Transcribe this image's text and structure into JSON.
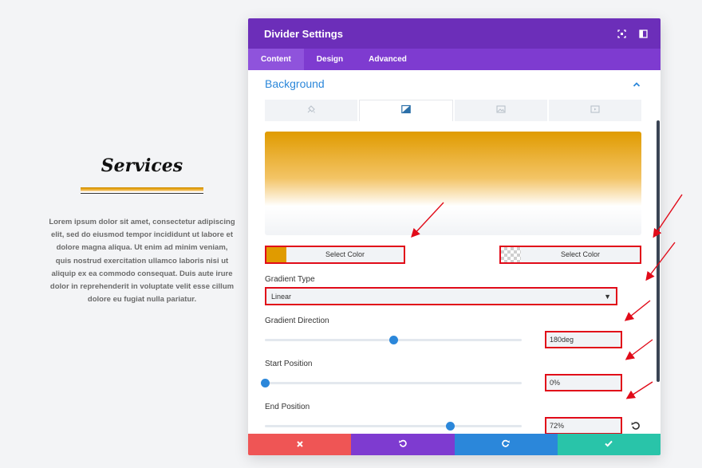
{
  "preview": {
    "heading": "Services",
    "body": "Lorem ipsum dolor sit amet, consectetur adipiscing elit, sed do eiusmod tempor incididunt ut labore et dolore magna aliqua. Ut enim ad minim veniam, quis nostrud exercitation ullamco laboris nisi ut aliquip ex ea commodo consequat. Duis aute irure dolor in reprehenderit in voluptate velit esse cillum dolore eu fugiat nulla pariatur."
  },
  "modal": {
    "title": "Divider Settings",
    "header_icons": [
      "fullscreen-icon",
      "sidebar-toggle-icon"
    ],
    "tabs": [
      {
        "label": "Content",
        "active": true
      },
      {
        "label": "Design",
        "active": false
      },
      {
        "label": "Advanced",
        "active": false
      }
    ],
    "section_title": "Background",
    "bg_tabs": [
      "paint-bucket-icon",
      "gradient-icon",
      "image-icon",
      "video-icon"
    ],
    "active_bg_tab": 1,
    "color_start": {
      "label": "Select Color",
      "color": "#e09b00"
    },
    "color_end": {
      "label": "Select Color",
      "color": "transparent"
    },
    "gradient_type": {
      "label": "Gradient Type",
      "value": "Linear"
    },
    "gradient_direction": {
      "label": "Gradient Direction",
      "value": "180deg",
      "level": 0.5
    },
    "start_position": {
      "label": "Start Position",
      "value": "0%",
      "level": 0
    },
    "end_position": {
      "label": "End Position",
      "value": "72%",
      "level": 0.72
    },
    "footer": [
      "cancel-icon",
      "undo-icon",
      "redo-icon",
      "save-check-icon"
    ]
  },
  "colors": {
    "header": "#6c2eb9",
    "tabs": "#7e3bd0",
    "accent": "#2b87da",
    "highlight": "#e10b19",
    "cancel": "#ef5555",
    "save": "#29c4a9"
  }
}
